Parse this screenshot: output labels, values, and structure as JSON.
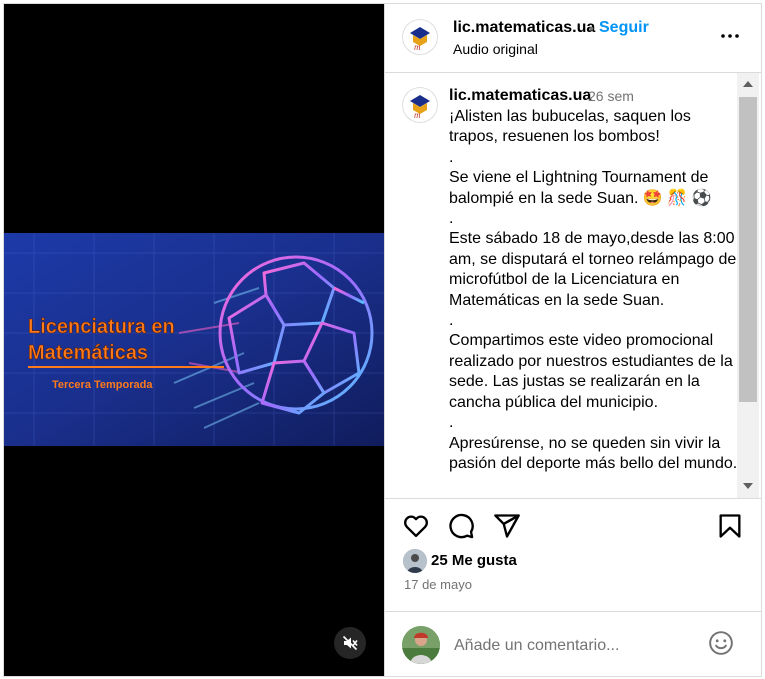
{
  "post": {
    "username": "lic.matematicas.ua",
    "separator": "•",
    "follow_label": "Seguir",
    "audio_label": "Audio original",
    "more_icon": "more-options-icon"
  },
  "media": {
    "title_line1": "Licenciatura en",
    "title_line2": "Matemáticas",
    "subtitle": "Tercera Temporada",
    "mute_icon": "speaker-muted-icon"
  },
  "caption": {
    "username": "lic.matematicas.ua",
    "time": "26 sem",
    "text": "¡Alisten las bubucelas, saquen los trapos, resuenen los bombos!\n.\nSe viene el Lightning Tournament de balompié en la sede Suan. 🤩 🎊 ⚽\n.\nEste sábado 18 de mayo,desde las 8:00 am, se disputará el torneo relámpago de microfútbol de la Licenciatura en Matemáticas en la sede Suan.\n.\nCompartimos este video promocional realizado por nuestros estudiantes de la sede. Las justas se realizarán en la cancha pública del municipio.\n.\nApresúrense, no se queden sin vivir la pasión del deporte más bello del mundo."
  },
  "actions": {
    "icons": [
      "heart-icon",
      "comment-icon",
      "share-icon",
      "bookmark-icon"
    ]
  },
  "likes": {
    "text": "25 Me gusta"
  },
  "date": {
    "text": "17 de mayo"
  },
  "composer": {
    "placeholder": "Añade un comentario...",
    "emoji_icon": "emoji-icon"
  },
  "colors": {
    "accent": "#0095f6",
    "media_bg": "#000000",
    "title_orange": "#ff7a1a"
  }
}
